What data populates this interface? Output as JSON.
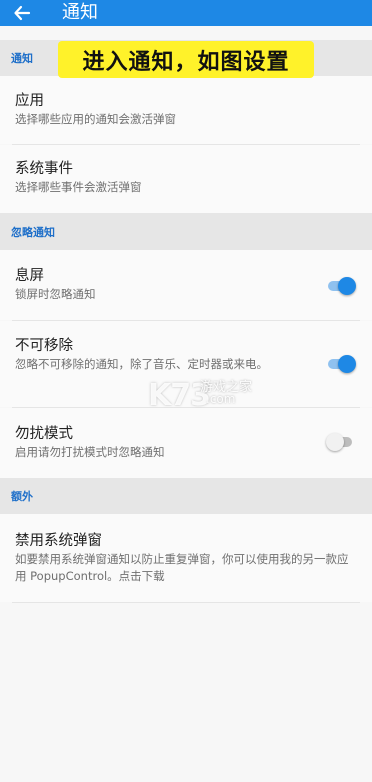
{
  "appbar": {
    "title": "通知"
  },
  "banner": {
    "text": "进入通知，如图设置"
  },
  "sections": {
    "notifications": {
      "label": "通知"
    },
    "ignore": {
      "label": "忽略通知"
    },
    "extra": {
      "label": "额外"
    }
  },
  "items": {
    "apps": {
      "title": "应用",
      "subtitle": "选择哪些应用的通知会激活弹窗"
    },
    "system_events": {
      "title": "系统事件",
      "subtitle": "选择哪些事件会激活弹窗"
    },
    "screen_off": {
      "title": "息屏",
      "subtitle": "锁屏时忽略通知",
      "enabled": true
    },
    "non_removable": {
      "title": "不可移除",
      "subtitle": "忽略不可移除的通知，除了音乐、定时器或来电。",
      "enabled": true
    },
    "dnd": {
      "title": "勿扰模式",
      "subtitle": "启用请勿打扰模式时忽略通知",
      "enabled": false
    },
    "disable_system_popup": {
      "title": "禁用系统弹窗",
      "subtitle": "如要禁用系统弹窗通知以防止重复弹窗，你可以使用我的另一款应用 PopupControl。点击下载"
    }
  },
  "watermark": {
    "logo": "K73",
    "name": "游戏之家",
    "domain": ".com"
  },
  "colors": {
    "accent": "#1e88e5",
    "banner": "#fff22a",
    "section_text": "#1e6fc9"
  }
}
